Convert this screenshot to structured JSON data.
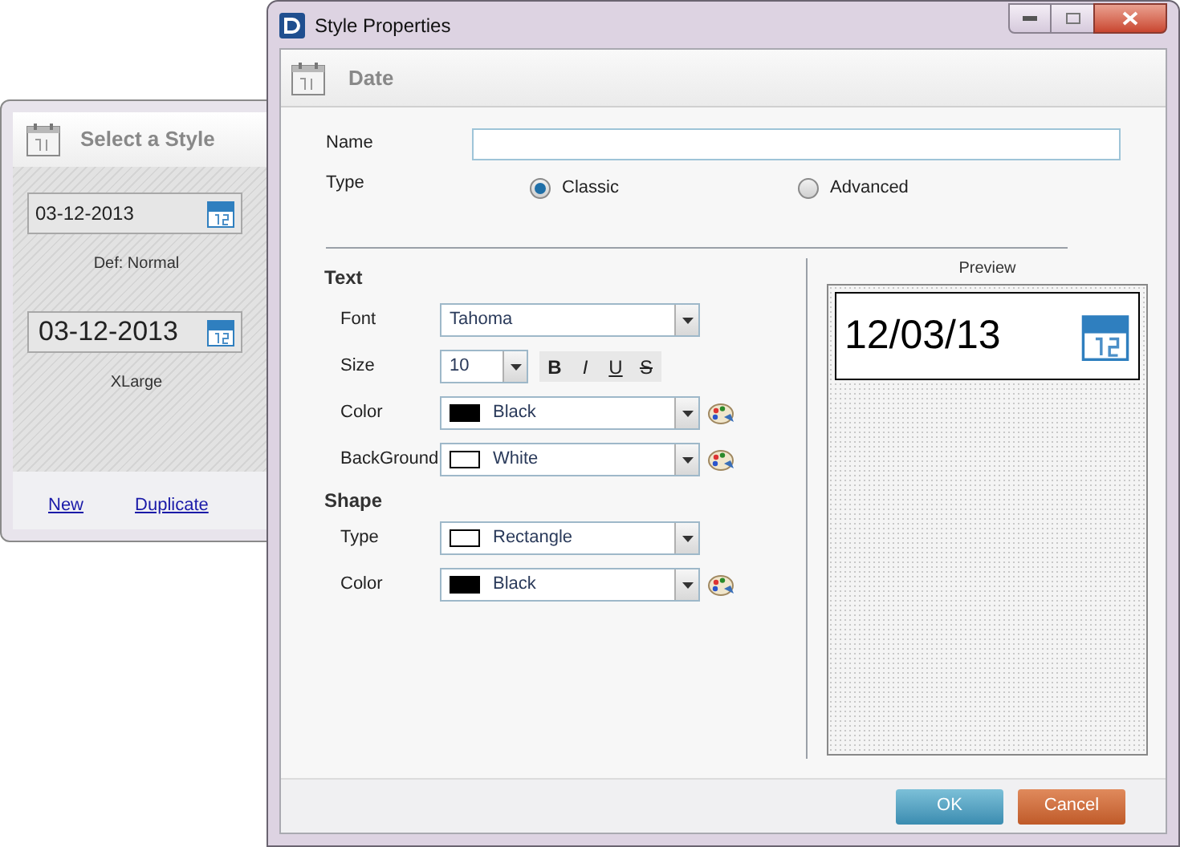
{
  "back_window": {
    "title": "Select a Style",
    "styles": [
      {
        "value": "03-12-2013",
        "label": "Def: Normal",
        "kind": "normal"
      },
      {
        "value": "03-12-2013",
        "label": "XLarge",
        "kind": "xlarge"
      }
    ],
    "links": [
      "New",
      "Duplicate"
    ]
  },
  "window": {
    "title": "Style Properties"
  },
  "header": {
    "title": "Date"
  },
  "name_field": {
    "label": "Name"
  },
  "type": {
    "label": "Type",
    "options": [
      {
        "label": "Classic",
        "selected": true
      },
      {
        "label": "Advanced",
        "selected": false
      }
    ]
  },
  "text_section": {
    "title": "Text",
    "font": {
      "label": "Font",
      "value": "Tahoma"
    },
    "size": {
      "label": "Size",
      "value": "10"
    },
    "format_buttons": [
      {
        "label": "B",
        "kind": "bold"
      },
      {
        "label": "I",
        "kind": "italic"
      },
      {
        "label": "U",
        "kind": "underline"
      },
      {
        "label": "S",
        "kind": "strike"
      }
    ],
    "color": {
      "label": "Color",
      "value": "Black",
      "color": "#000000"
    },
    "background": {
      "label": "BackGround",
      "value": "White",
      "color": "#ffffff"
    }
  },
  "shape_section": {
    "title": "Shape",
    "type": {
      "label": "Type",
      "value": "Rectangle",
      "color": "#ffffff"
    },
    "color": {
      "label": "Color",
      "value": "Black",
      "color": "#000000"
    }
  },
  "preview": {
    "label": "Preview",
    "value": "12/03/13"
  },
  "buttons": [
    {
      "label": "OK",
      "kind": "primary"
    },
    {
      "label": "Cancel",
      "kind": "danger"
    }
  ]
}
